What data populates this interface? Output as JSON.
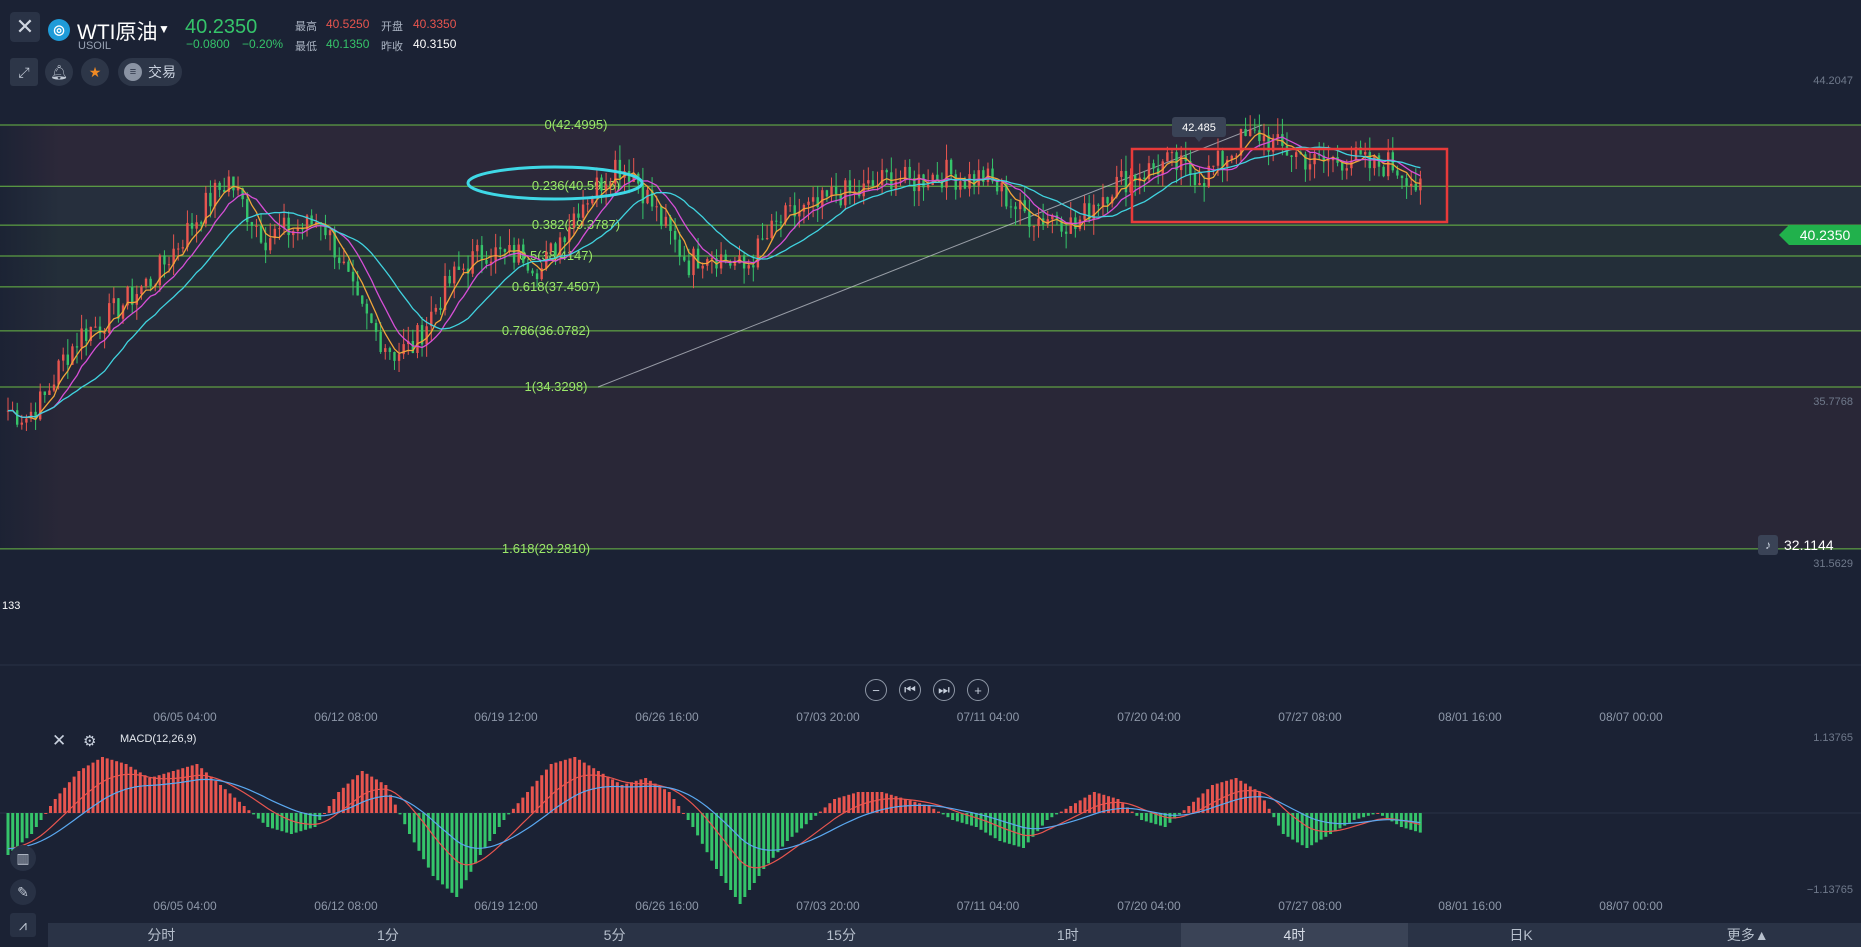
{
  "header": {
    "symbol_name": "WTI原油",
    "symbol_code": "USOIL",
    "last_price": "40.2350",
    "change": "−0.0800",
    "change_pct": "−0.20%",
    "high_label": "最高",
    "high_value": "40.5250",
    "open_label": "开盘",
    "open_value": "40.3350",
    "low_label": "最低",
    "low_value": "40.1350",
    "prev_close_label": "昨收",
    "prev_close_value": "40.3150",
    "trade_label": "交易"
  },
  "icons": {
    "close": "close-icon",
    "draw": "draw-tool-icon",
    "alert": "bell-icon",
    "favorite": "star-icon",
    "trade": "list-icon"
  },
  "colors": {
    "background": "#1b2234",
    "up": "#e8554f",
    "down": "#35c46a",
    "fib_line": "#7ee04a",
    "ma_orange": "#f0a53a",
    "ma_magenta": "#d64fd6",
    "ma_cyan": "#40d3df",
    "highlight_ellipse": "#3fd8e6",
    "highlight_rect": "#e83a3a"
  },
  "price_axis": {
    "labels": [
      "44.2047",
      "35.7768",
      "31.5629"
    ],
    "current_price_tag": "40.2350",
    "alert_price": "32.1144",
    "left_cut_label": "133",
    "callout_high": "42.485"
  },
  "fibonacci": [
    {
      "label": "0(42.4995)",
      "price": 42.4995
    },
    {
      "label": "0.236(40.5915)",
      "price": 40.5915
    },
    {
      "label": "0.382(39.3787)",
      "price": 39.3787
    },
    {
      "label": "0.5(38.4147)",
      "price": 38.4147
    },
    {
      "label": "0.618(37.4507)",
      "price": 37.4507
    },
    {
      "label": "0.786(36.0782)",
      "price": 36.0782
    },
    {
      "label": "1(34.3298)",
      "price": 34.3298
    },
    {
      "label": "1.618(29.2810)",
      "price": 29.281
    }
  ],
  "time_axis": [
    "06/05 04:00",
    "06/12 08:00",
    "06/19 12:00",
    "06/26 16:00",
    "07/03 20:00",
    "07/11 04:00",
    "07/20 04:00",
    "07/27 08:00",
    "08/01 16:00",
    "08/07 00:00"
  ],
  "macd": {
    "title": "MACD(12,26,9)",
    "axis_top": "1.13765",
    "axis_bottom": "−1.13765"
  },
  "chart_data": {
    "type": "candlestick",
    "series_main_close": [
      33.6,
      33.4,
      34.0,
      35.2,
      36.0,
      36.3,
      36.8,
      37.3,
      37.8,
      38.6,
      39.4,
      40.2,
      40.8,
      39.8,
      39.0,
      39.2,
      39.3,
      39.6,
      38.4,
      36.8,
      36.0,
      35.4,
      35.6,
      36.6,
      37.6,
      38.2,
      38.6,
      38.4,
      38.5,
      38.0,
      39.0,
      40.0,
      40.6,
      41.3,
      41.0,
      40.0,
      39.0,
      38.2,
      38.6,
      38.3,
      38.0,
      38.8,
      39.5,
      39.8,
      39.9,
      40.4,
      40.3,
      40.6,
      40.9,
      40.7,
      40.9,
      41.0,
      40.8,
      40.9,
      40.4,
      39.8,
      39.6,
      39.7,
      39.3,
      40.1,
      40.6,
      40.9,
      41.1,
      41.3,
      41.1,
      40.9,
      41.4,
      42.0,
      42.2,
      41.8,
      41.6,
      41.3,
      41.4,
      41.5,
      41.2,
      41.3,
      41.0,
      40.2
    ],
    "volume_note": "",
    "macd_hist": [
      -0.6,
      -0.3,
      0.2,
      0.6,
      0.8,
      0.7,
      0.5,
      0.6,
      0.7,
      0.4,
      0.1,
      -0.2,
      -0.3,
      -0.2,
      0.3,
      0.6,
      0.4,
      -0.3,
      -0.9,
      -1.2,
      -0.6,
      -0.1,
      0.3,
      0.7,
      0.8,
      0.6,
      0.4,
      0.5,
      0.3,
      -0.2,
      -0.8,
      -1.3,
      -0.8,
      -0.4,
      -0.1,
      0.2,
      0.3,
      0.3,
      0.2,
      0.1,
      -0.1,
      -0.2,
      -0.4,
      -0.5,
      -0.1,
      0.1,
      0.3,
      0.2,
      -0.1,
      -0.2,
      0.1,
      0.4,
      0.5,
      0.3,
      -0.3,
      -0.5,
      -0.3,
      -0.1,
      0.0,
      -0.2,
      -0.3
    ],
    "ylim": [
      29.0,
      44.2
    ]
  },
  "bottom_tabs": [
    "分时",
    "1分",
    "5分",
    "15分",
    "1时",
    "4时",
    "日K",
    "更多▲"
  ],
  "active_tab": "4时"
}
